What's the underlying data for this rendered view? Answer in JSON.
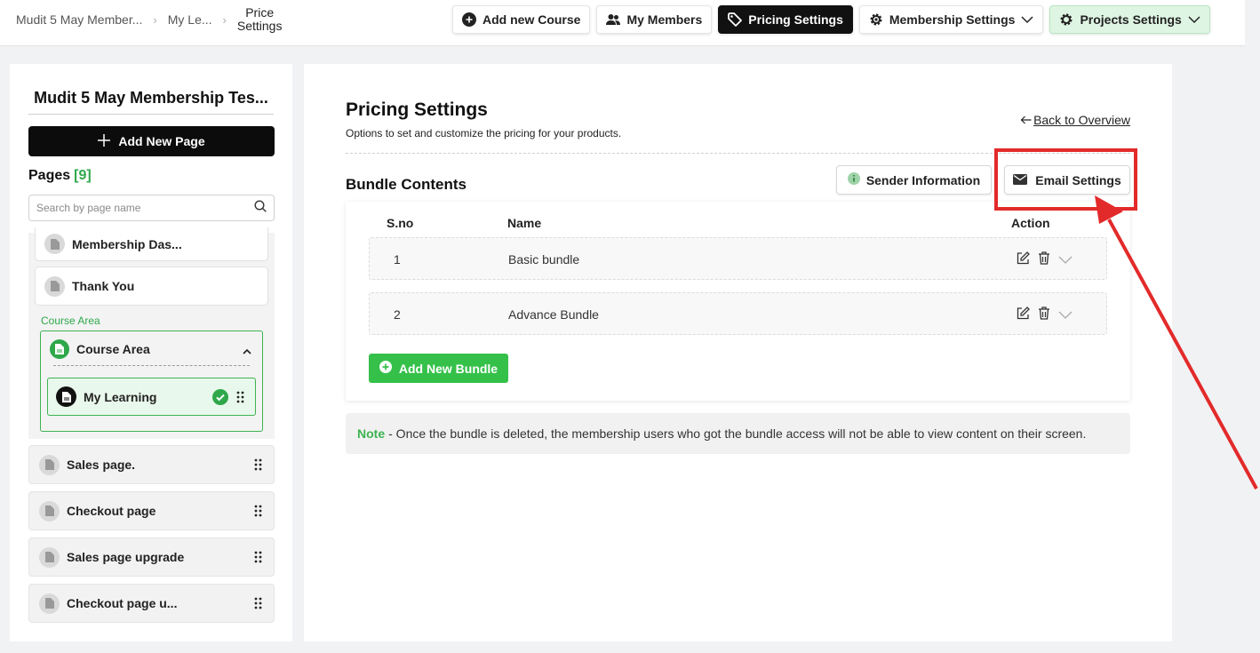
{
  "breadcrumb": {
    "items": [
      "Mudit 5 May Member...",
      "My Le..."
    ],
    "current_line1": "Price",
    "current_line2": "Settings"
  },
  "topnav": {
    "add_course": "Add new Course",
    "my_members": "My Members",
    "pricing_settings": "Pricing Settings",
    "membership_settings": "Membership Settings",
    "projects_settings": "Projects Settings"
  },
  "sidebar": {
    "title": "Mudit 5 May Membership Tes...",
    "add_page": "Add New Page",
    "pages_label": "Pages",
    "pages_count": "[9]",
    "search_placeholder": "Search by page name",
    "items": {
      "membership_dashboard": "Membership Das...",
      "thank_you": "Thank You",
      "course_area_label": "Course Area",
      "course_area": "Course Area",
      "my_learning": "My Learning",
      "sales_page": "Sales page.",
      "checkout_page": "Checkout page",
      "sales_page_upgrade": "Sales page upgrade",
      "checkout_page_upgrade": "Checkout page u..."
    }
  },
  "main": {
    "title": "Pricing Settings",
    "subtitle": "Options to set and customize the pricing for your products.",
    "back_link": "Back to Overview",
    "bundle_title": "Bundle Contents",
    "sender_info": "Sender Information",
    "email_settings": "Email Settings",
    "table": {
      "headers": {
        "sno": "S.no",
        "name": "Name",
        "action": "Action"
      },
      "rows": [
        {
          "sno": "1",
          "name": "Basic bundle"
        },
        {
          "sno": "2",
          "name": "Advance Bundle"
        }
      ]
    },
    "add_bundle": "Add New Bundle",
    "note_label": "Note",
    "note_text": "- Once the bundle is deleted, the membership users who got the bundle access will not be able to view content on their screen."
  },
  "colors": {
    "accent_green": "#35c04a",
    "annotation_red": "#e32a2a",
    "dark_button": "#111111"
  },
  "icons": [
    "plus-circle-icon",
    "users-icon",
    "tag-icon",
    "gear-icon",
    "chevron-down-icon",
    "plus-icon",
    "search-icon",
    "document-icon",
    "check-circle-icon",
    "drag-handle-icon",
    "chevron-up-icon",
    "arrow-left-icon",
    "info-icon",
    "envelope-icon",
    "edit-icon",
    "trash-icon"
  ]
}
